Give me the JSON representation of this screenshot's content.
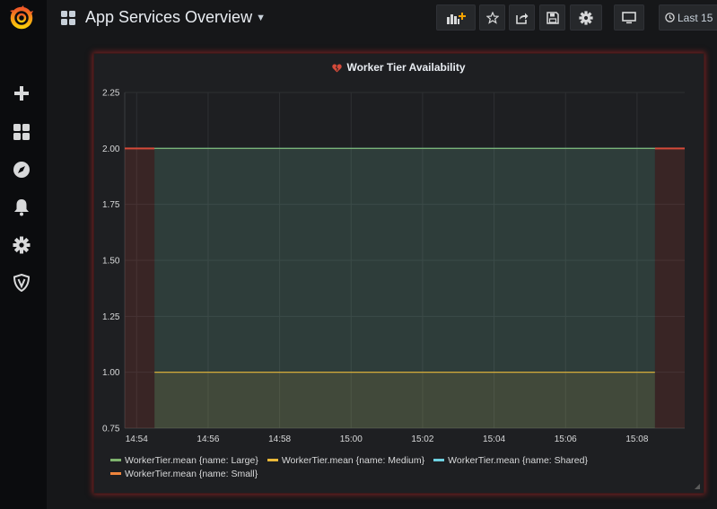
{
  "sidebar": {
    "icons": [
      "grafana-logo-icon",
      "plus-icon",
      "dashboards-icon",
      "explore-icon",
      "alert-bell-icon",
      "gear-icon",
      "shield-icon"
    ]
  },
  "header": {
    "title": "App Services Overview",
    "time_range_label": "Last 15"
  },
  "panel": {
    "title": "Worker Tier Availability",
    "state_color": "#d44a3a"
  },
  "chart_data": {
    "type": "area",
    "title": "Worker Tier Availability",
    "xlabel": "",
    "ylabel": "",
    "x_ticks": [
      "14:54",
      "14:56",
      "14:58",
      "15:00",
      "15:02",
      "15:04",
      "15:06",
      "15:08"
    ],
    "y_ticks": [
      "0.75",
      "1.00",
      "1.25",
      "1.50",
      "1.75",
      "2.00",
      "2.25"
    ],
    "ylim": [
      0.75,
      2.25
    ],
    "xlim": [
      "14:53:40",
      "15:09:20"
    ],
    "grid": true,
    "legend_position": "bottom",
    "series": [
      {
        "name": "WorkerTier.mean {name: Large}",
        "color": "#7eb26d",
        "x": [
          "14:54:30",
          "15:08:30"
        ],
        "values": [
          2,
          2
        ]
      },
      {
        "name": "WorkerTier.mean {name: Medium}",
        "color": "#eab839",
        "x": [
          "14:54:30",
          "15:08:30"
        ],
        "values": [
          1,
          1
        ]
      },
      {
        "name": "WorkerTier.mean {name: Shared}",
        "color": "#6ed0e0",
        "x": [
          "14:54:30",
          "15:08:30"
        ],
        "values": [
          2,
          2
        ]
      },
      {
        "name": "WorkerTier.mean {name: Small}",
        "color": "#ef843c",
        "x": [],
        "values": []
      }
    ],
    "alert_threshold": {
      "value": 2,
      "color": "#d44a3a"
    }
  }
}
